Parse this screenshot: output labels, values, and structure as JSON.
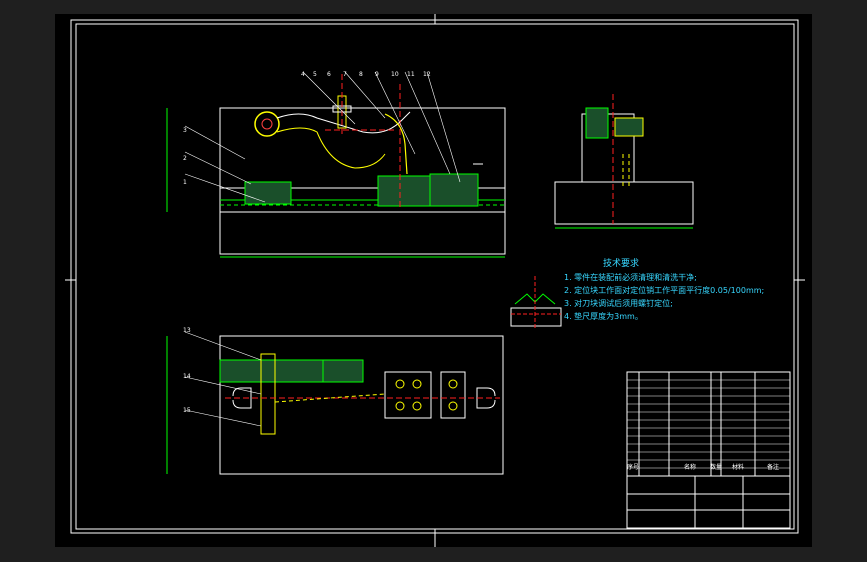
{
  "drawing": {
    "tech_title": "技术要求",
    "requirements": [
      "1. 零件在装配前必须清理和清洗干净;",
      "2. 定位块工作面对定位销工作平面平行度0.05/100mm;",
      "3. 对刀块调试后须用螺钉定位;",
      "4. 垫尺厚度为3mm。"
    ],
    "callouts_front": [
      "1",
      "2",
      "3",
      "4",
      "5",
      "6",
      "7",
      "8",
      "9",
      "10",
      "11",
      "12"
    ],
    "callouts_top": [
      "13",
      "14",
      "15"
    ],
    "bom_headers": [
      "序号",
      "名称",
      "数量",
      "材料",
      "备注"
    ],
    "colors": {
      "line": "#ffffff",
      "green": "#00ff00",
      "yellow": "#ffff00",
      "red": "#ff2020",
      "cyan": "#37d7ff",
      "magenta": "#ff40ff"
    }
  }
}
